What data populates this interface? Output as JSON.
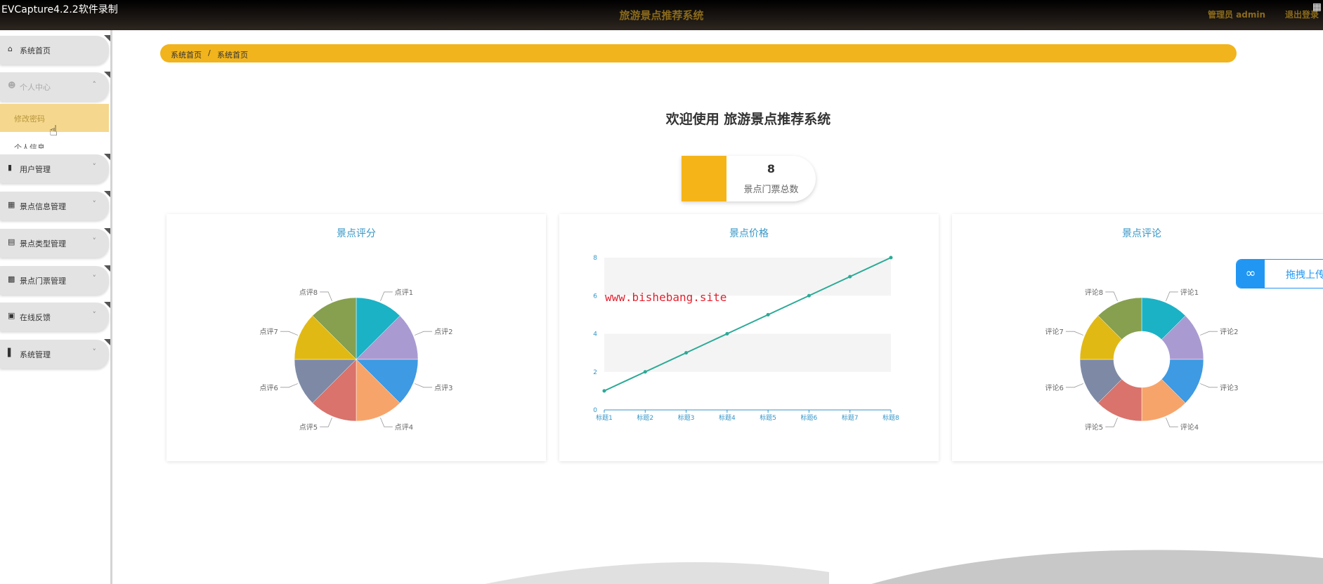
{
  "recorder": {
    "label": "EVCapture4.2.2软件录制",
    "icon": "grid-icon"
  },
  "header": {
    "title": "旅游景点推荐系统",
    "admin": "管理员 admin",
    "logout": "退出登录"
  },
  "sidebar": {
    "items": [
      {
        "label": "系统首页",
        "icon": "home-icon"
      },
      {
        "label": "个人中心",
        "icon": "user-icon",
        "expanded": true
      },
      {
        "label": "用户管理",
        "icon": "user-card-icon"
      },
      {
        "label": "景点信息管理",
        "icon": "grid-icon"
      },
      {
        "label": "景点类型管理",
        "icon": "briefcase-icon"
      },
      {
        "label": "景点门票管理",
        "icon": "ticket-icon"
      },
      {
        "label": "在线反馈",
        "icon": "clipboard-icon"
      },
      {
        "label": "系统管理",
        "icon": "bar-chart-icon"
      }
    ],
    "submenu": {
      "active": "修改密码",
      "next": "个人信息"
    }
  },
  "breadcrumb": {
    "home": "系统首页",
    "separator": "/",
    "current": "系统首页"
  },
  "welcome": "欢迎使用 旅游景点推荐系统",
  "stat": {
    "value": "8",
    "label": "景点门票总数",
    "color": "#f5b519"
  },
  "watermark": "www.bishebang.site",
  "upload": {
    "label": "拖拽上传"
  },
  "chart_data": [
    {
      "type": "pie",
      "title": "景点评分",
      "categories": [
        "点评1",
        "点评2",
        "点评3",
        "点评4",
        "点评5",
        "点评6",
        "点评7",
        "点评8"
      ],
      "values": [
        1,
        1,
        1,
        1,
        1,
        1,
        1,
        1
      ]
    },
    {
      "type": "line",
      "title": "景点价格",
      "categories": [
        "标题1",
        "标题2",
        "标题3",
        "标题4",
        "标题5",
        "标题6",
        "标题7",
        "标题8"
      ],
      "values": [
        1,
        2,
        3,
        4,
        5,
        6,
        7,
        8
      ],
      "ylim": [
        0,
        8
      ],
      "yticks": [
        0,
        2,
        4,
        6,
        8
      ]
    },
    {
      "type": "pie",
      "title": "景点评论",
      "donut": true,
      "categories": [
        "评论1",
        "评论2",
        "评论3",
        "评论4",
        "评论5",
        "评论6",
        "评论7",
        "评论8"
      ],
      "values": [
        1,
        1,
        1,
        1,
        1,
        1,
        1,
        1
      ]
    }
  ],
  "colors": {
    "accent": "#f2b41c",
    "pie_colors": [
      "#1bb2c5",
      "#a99bd1",
      "#3e9ae2",
      "#f7a46b",
      "#d9736c",
      "#7e8aa5",
      "#e1b915",
      "#86a04f"
    ],
    "line": "#2aaa96"
  }
}
